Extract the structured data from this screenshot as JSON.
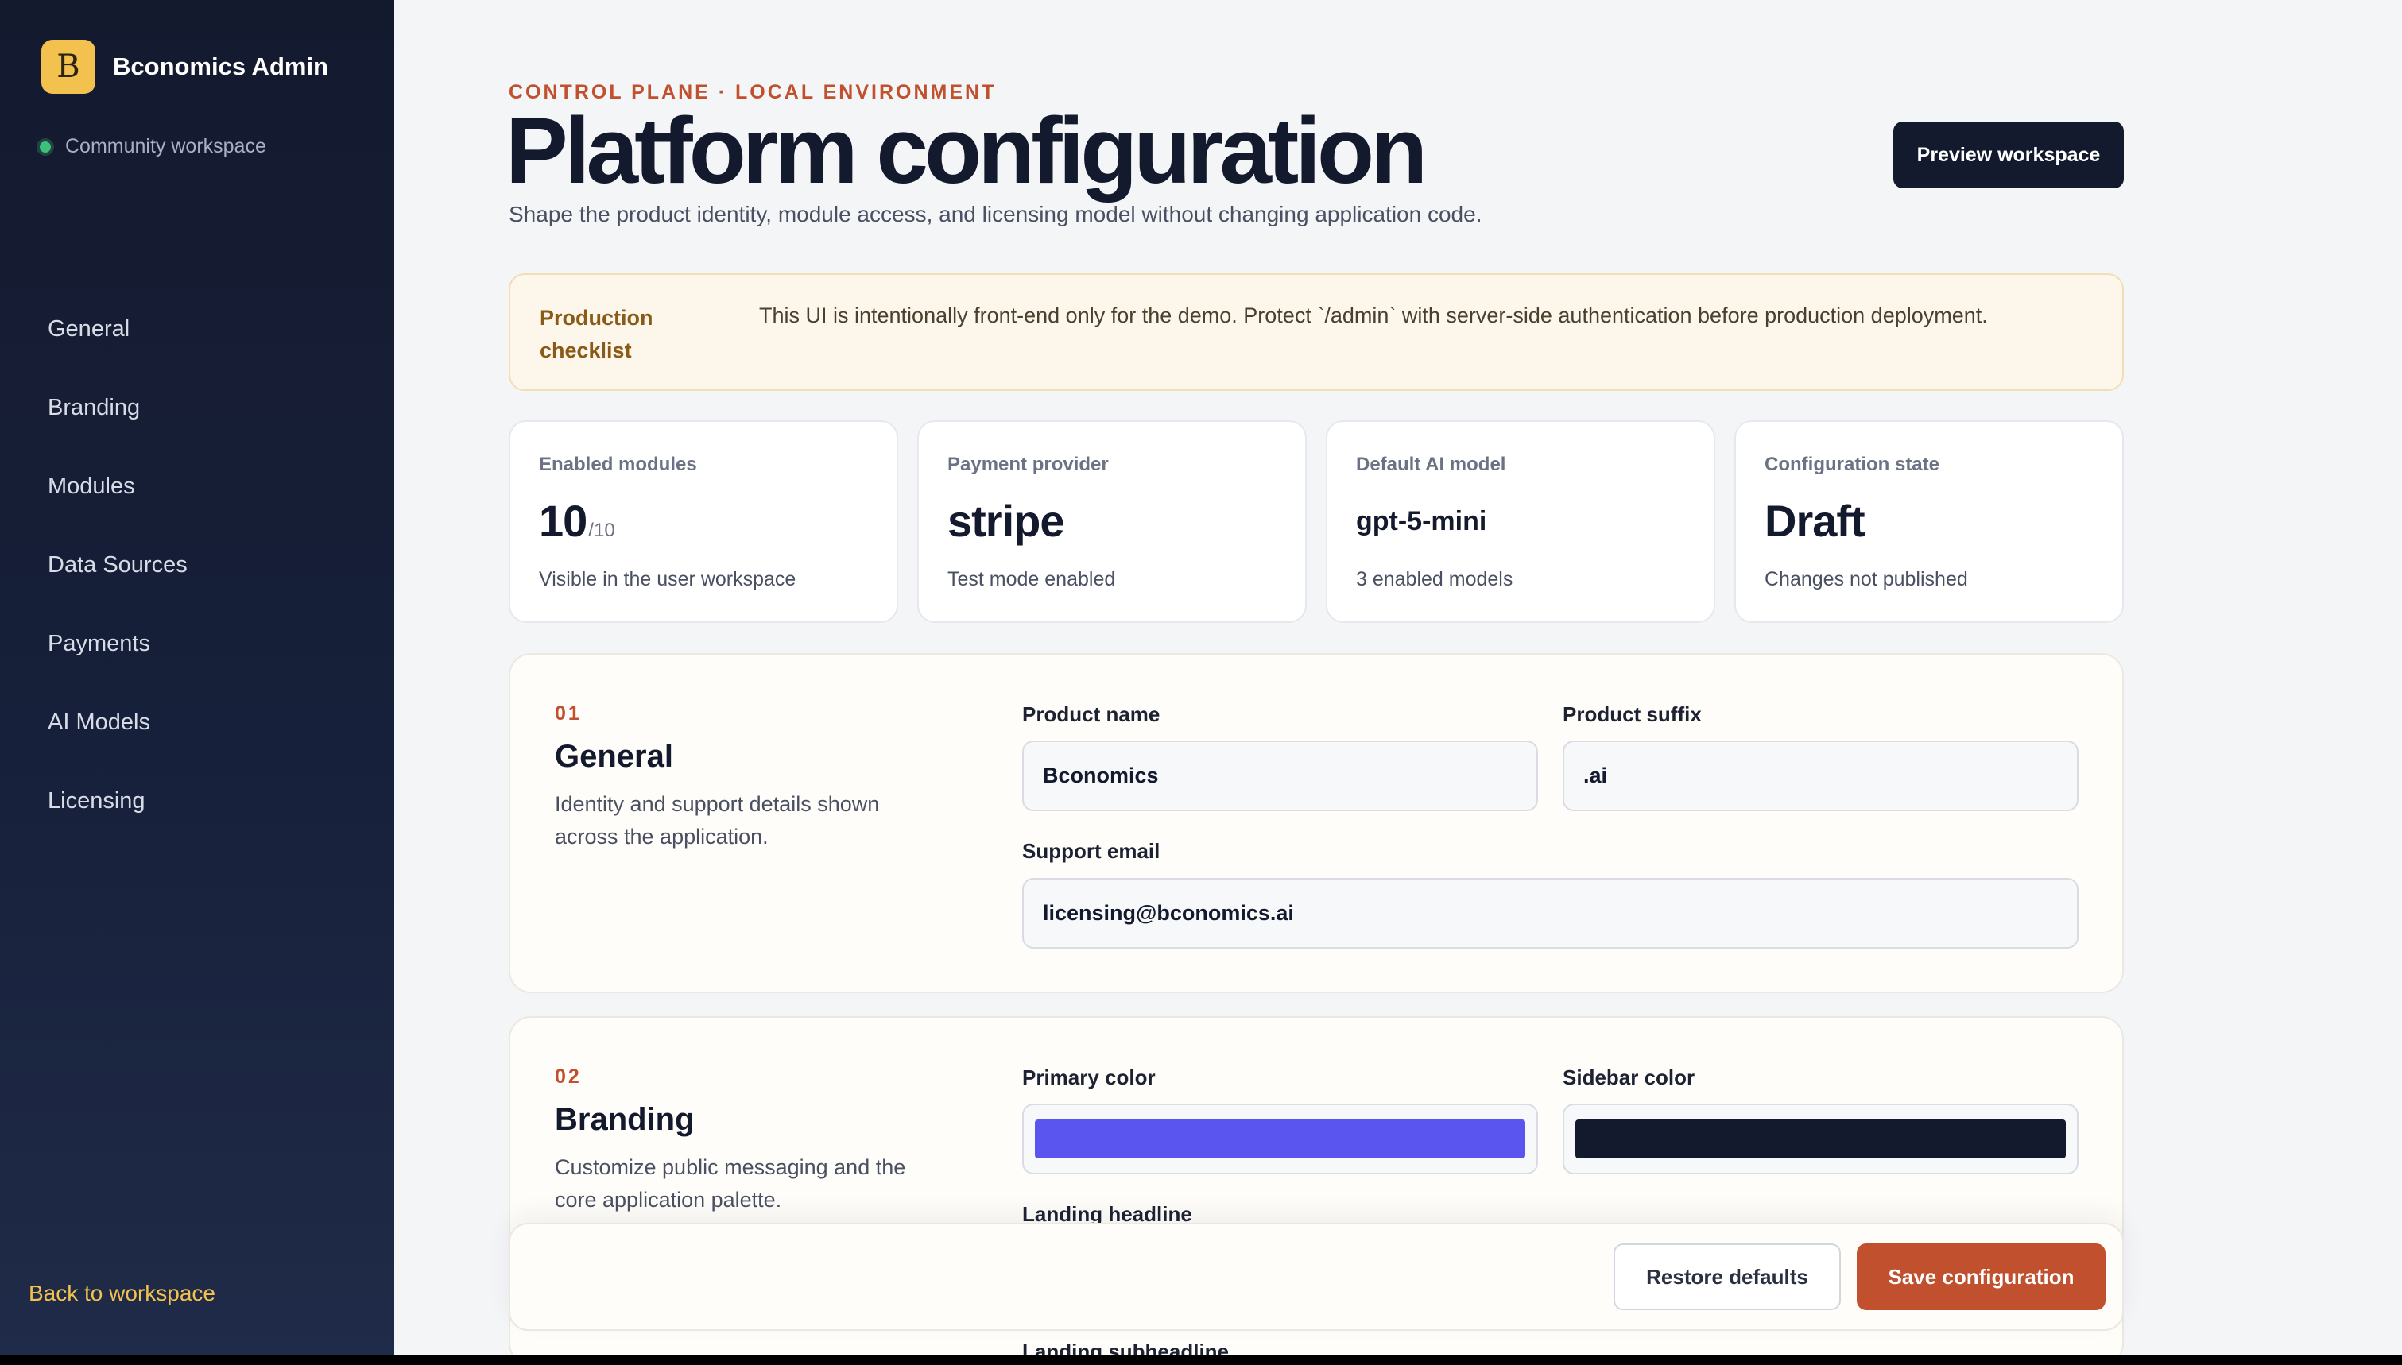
{
  "sidebar": {
    "brand_initial": "B",
    "brand_name": "Bconomics Admin",
    "workspace_label": "Community workspace",
    "items": [
      {
        "label": "General"
      },
      {
        "label": "Branding"
      },
      {
        "label": "Modules"
      },
      {
        "label": "Data Sources"
      },
      {
        "label": "Payments"
      },
      {
        "label": "AI Models"
      },
      {
        "label": "Licensing"
      }
    ],
    "back_link": "Back to workspace"
  },
  "header": {
    "eyebrow": "CONTROL PLANE · LOCAL ENVIRONMENT",
    "title": "Platform configuration",
    "subtitle": "Shape the product identity, module access, and licensing model without changing application code.",
    "preview_button": "Preview workspace"
  },
  "notice": {
    "title": "Production checklist",
    "text": "This UI is intentionally front-end only for the demo. Protect `/admin` with server-side authentication before production deployment."
  },
  "stats": [
    {
      "label": "Enabled modules",
      "value": "10",
      "suffix": "/10",
      "note": "Visible in the user workspace"
    },
    {
      "label": "Payment provider",
      "value": "stripe",
      "note": "Test mode enabled"
    },
    {
      "label": "Default AI model",
      "value": "gpt-5-mini",
      "note": "3 enabled models"
    },
    {
      "label": "Configuration state",
      "value": "Draft",
      "note": "Changes not published"
    }
  ],
  "general": {
    "number": "01",
    "title": "General",
    "description": "Identity and support details shown across the application.",
    "product_name_label": "Product name",
    "product_name_value": "Bconomics",
    "product_suffix_label": "Product suffix",
    "product_suffix_value": ".ai",
    "support_email_label": "Support email",
    "support_email_value": "licensing@bconomics.ai"
  },
  "branding": {
    "number": "02",
    "title": "Branding",
    "description": "Customize public messaging and the core application palette.",
    "primary_color_label": "Primary color",
    "primary_color": "#5b55ef",
    "sidebar_color_label": "Sidebar color",
    "sidebar_color": "#141a2e",
    "landing_headline_label": "Landing headline",
    "landing_subheadline_label": "Landing subheadline"
  },
  "actions": {
    "restore": "Restore defaults",
    "save": "Save configuration"
  }
}
